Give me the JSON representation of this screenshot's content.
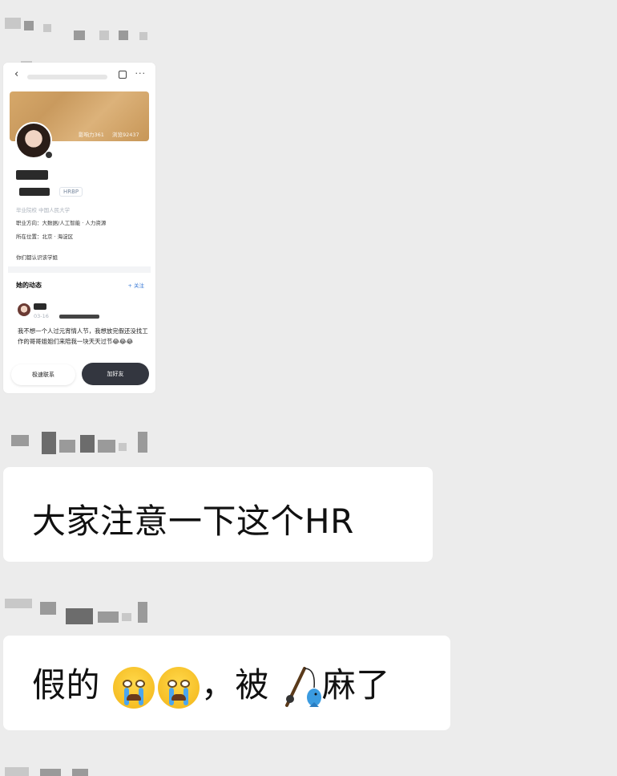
{
  "chat": {
    "messages": [
      {
        "type": "screenshot"
      },
      {
        "type": "text",
        "text": "大家注意一下这个HR"
      },
      {
        "type": "text",
        "text_before": "假的",
        "emoji": [
          "crying-face",
          "crying-face"
        ],
        "text_mid": "，被",
        "emoji2": "fishing-pole-fish",
        "text_after": "麻了"
      }
    ]
  },
  "profile_screenshot": {
    "stats": {
      "influence": "影响力361",
      "fans": "浏览92437"
    },
    "title_badge": "HRBP",
    "school_line": "毕业院校 中国人民大学",
    "direction": "职业方向：大数据/人工智能 · 人力资源",
    "location": "所在位置：北京 · 海淀区",
    "mutual": "你们都认识该学姐",
    "feed_title": "她的动态",
    "follow": "+ 关注",
    "post_date": "03-16",
    "post_text": "我不想一个人过元宵情人节，我想放完假还没找工作的哥哥姐姐们来陪我一块天天过节😂😂😂",
    "btn_contact": "极速联系",
    "btn_add": "加好友"
  },
  "colors": {
    "background": "#ececec",
    "bubble": "#ffffff",
    "button_dark": "#33363f",
    "accent_blue": "#3b7bd6"
  }
}
